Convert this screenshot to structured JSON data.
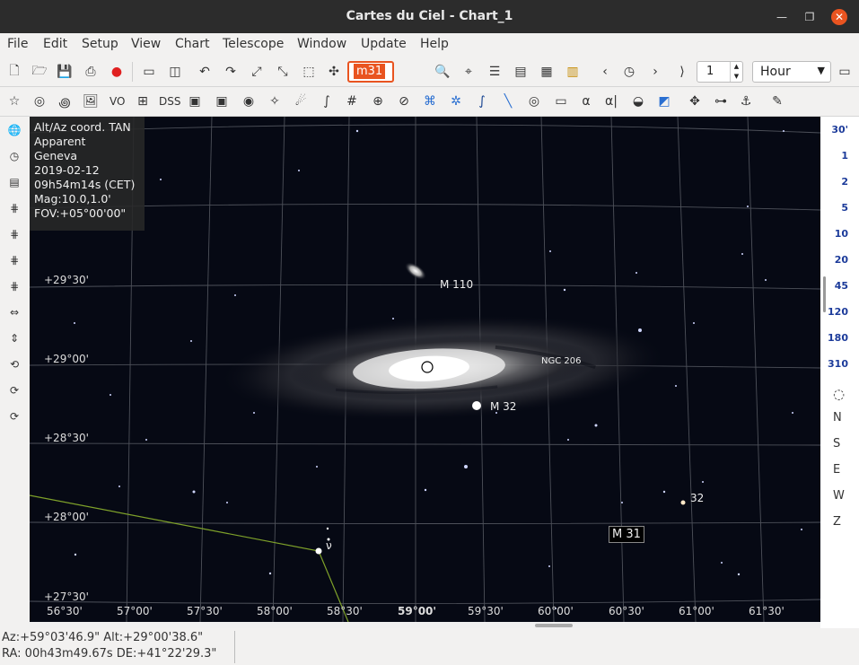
{
  "window": {
    "title": "Cartes du Ciel - Chart_1"
  },
  "menu": [
    "File",
    "Edit",
    "Setup",
    "View",
    "Chart",
    "Telescope",
    "Window",
    "Update",
    "Help"
  ],
  "toolbar": {
    "search_value": "m31",
    "time_step_value": "1",
    "time_unit": "Hour",
    "vo_label": "VO",
    "dss_label": "DSS",
    "alpha_label": "α",
    "alpha2_label": "α|"
  },
  "chart": {
    "info": [
      "Alt/Az coord. TAN",
      "Apparent",
      "Geneva",
      "2019-02-12",
      "09h54m14s (CET)",
      "Mag:10.0,1.0'",
      "FOV:+05°00'00\""
    ],
    "dec_labels": [
      "+29°30'",
      "+29°00'",
      "+28°30'",
      "+28°00'",
      "+27°30'"
    ],
    "ra_labels": [
      "56°30'",
      "57°00'",
      "57°30'",
      "58°00'",
      "58°30'",
      "59°00'",
      "59°30'",
      "60°00'",
      "60°30'",
      "61°00'",
      "61°30'"
    ],
    "objects": {
      "m110": "M 110",
      "ngc206": "NGC 206",
      "m32": "M 32",
      "star32": "32",
      "nu": "ν"
    },
    "selected_label": "M 31"
  },
  "fov_buttons": [
    "30'",
    "1",
    "2",
    "5",
    "10",
    "20",
    "45",
    "120",
    "180",
    "310"
  ],
  "right_buttons": {
    "n": "N",
    "s": "S",
    "e": "E",
    "w": "W",
    "z": "Z"
  },
  "status": {
    "azalt": "Az:+59°03'46.9\" Alt:+29°00'38.6\"",
    "radec": "RA: 00h43m49.67s DE:+41°22'29.3\""
  },
  "colors": {
    "accent": "#e95420",
    "fov_text": "#1c3b9a",
    "sky": "#060914"
  }
}
